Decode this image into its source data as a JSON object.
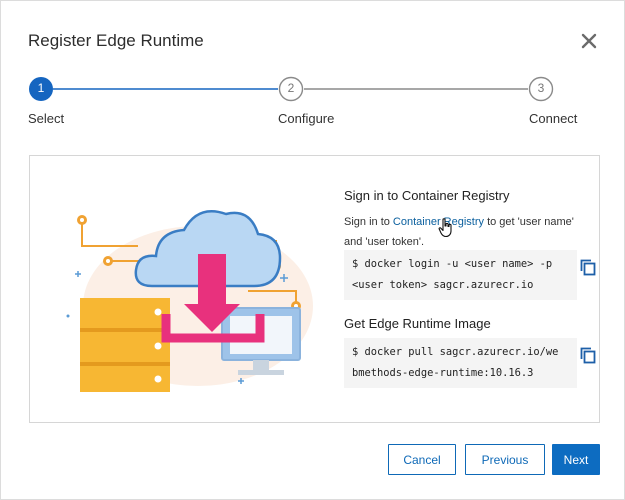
{
  "dialog": {
    "title": "Register Edge Runtime",
    "close_icon": "close-icon"
  },
  "stepper": {
    "steps": [
      {
        "number": "1",
        "label": "Select",
        "state": "active"
      },
      {
        "number": "2",
        "label": "Configure",
        "state": "inactive"
      },
      {
        "number": "3",
        "label": "Connect",
        "state": "inactive"
      }
    ]
  },
  "section1": {
    "heading": "Sign in to Container Registry",
    "text_before": "Sign in to ",
    "link": "Container Registry",
    "text_after": " to get 'user name' and 'user token'.",
    "code_line1": "$ docker login -u <user name> -p",
    "code_line2": "<user token> sagcr.azurecr.io"
  },
  "section2": {
    "heading": "Get Edge Runtime Image",
    "code_line1": "$ docker pull sagcr.azurecr.io/we",
    "code_line2": "bmethods-edge-runtime:10.16.3"
  },
  "buttons": {
    "cancel": "Cancel",
    "previous": "Previous",
    "next": "Next"
  },
  "colors": {
    "accent": "#0d6cc1",
    "active_step": "#1565c0",
    "inactive_line": "#8a8a8a",
    "link": "#0a5f9e"
  },
  "icons": [
    "close-icon",
    "copy-icon",
    "hand-cursor-icon"
  ]
}
